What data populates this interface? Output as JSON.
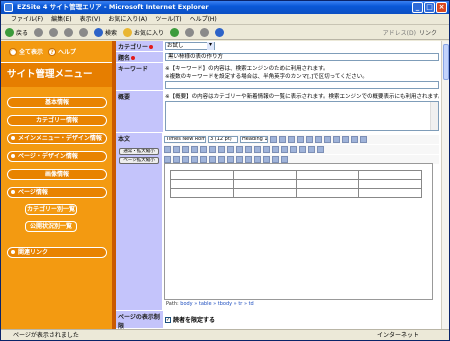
{
  "window": {
    "title": "EZSite 4 サイト管理エリア - Microsoft Internet Explorer"
  },
  "menubar": [
    "ファイル(F)",
    "編集(E)",
    "表示(V)",
    "お気に入り(A)",
    "ツール(T)",
    "ヘルプ(H)"
  ],
  "toolbar": {
    "back": "戻る",
    "search": "検索",
    "favorites": "お気に入り",
    "address_label": "アドレス(D)",
    "links": "リンク"
  },
  "sidebar": {
    "top_all": "全て表示",
    "top_help": "ヘルプ",
    "title": "サイト管理メニュー",
    "items": [
      {
        "label": "基本情報"
      },
      {
        "label": "カテゴリー情報"
      },
      {
        "label": "メインメニュー・デザイン情報"
      },
      {
        "label": "ページ・デザイン情報"
      },
      {
        "label": "画像情報"
      },
      {
        "label": "ページ情報"
      },
      {
        "label": "カテゴリー別一覧"
      },
      {
        "label": "公開状況別一覧"
      },
      {
        "label": "関連リンク"
      }
    ]
  },
  "form": {
    "category_label": "カテゴリー",
    "category_value": "お試し",
    "title_label": "題名",
    "title_value": "黒い柿様の表の作り方",
    "keyword_label": "キーワード",
    "keyword_help1": "※【キーワード】の内容は、検索エンジンのために利用されます。",
    "keyword_help2": "※複数のキーワードを設定する場合は、半角英字のカンマ[,]で区切ってください。",
    "summary_label": "概要",
    "summary_help": "※【概要】の内容はカテゴリーや新着情報の一覧に表示されます。検索エンジンでの概要表示にも利用されます。",
    "body_label": "本文",
    "editor_btn1": "通常・拡大縮小",
    "editor_btn2": "ページ拡大縮小",
    "font_name": "Times New Roman",
    "font_size": "3 (12 pt)",
    "heading": "Heading 1",
    "path_label": "Path:",
    "path_value": "body » table » tbody » tr » td",
    "display_label": "ページの表示制限",
    "display_option": "読者を限定する"
  },
  "status": {
    "left": "ページが表示されました",
    "zone": "インターネット"
  }
}
